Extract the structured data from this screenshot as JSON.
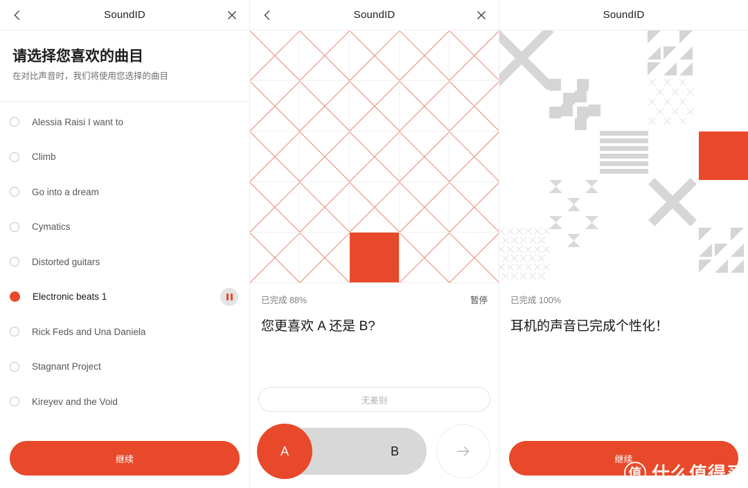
{
  "colors": {
    "accent": "#E8492A",
    "accent_light": "#E98571",
    "gray_shape": "#d5d5d5",
    "toggle_track": "#d8d8d8"
  },
  "panels": {
    "left": {
      "appbar": {
        "title": "SoundID",
        "back_icon": "chevron-left-icon",
        "close_icon": "close-icon"
      },
      "intro": {
        "title": "请选择您喜欢的曲目",
        "subtitle": "在对比声音时，我们将使用您选择的曲目"
      },
      "tracks": [
        {
          "label": "Alessia Raisi I want to",
          "selected": false
        },
        {
          "label": "Climb",
          "selected": false
        },
        {
          "label": "Go into a dream",
          "selected": false
        },
        {
          "label": "Cymatics",
          "selected": false
        },
        {
          "label": "Distorted guitars",
          "selected": false
        },
        {
          "label": "Electronic beats 1",
          "selected": true
        },
        {
          "label": "Rick Feds and Una Daniela",
          "selected": false
        },
        {
          "label": "Stagnant Project",
          "selected": false
        },
        {
          "label": "Kireyev and the Void",
          "selected": false
        }
      ],
      "pause_icon": "pause-icon",
      "cta_label": "继续"
    },
    "middle": {
      "appbar": {
        "title": "SoundID",
        "back_icon": "chevron-left-icon",
        "close_icon": "close-icon"
      },
      "progress_label": "已完成 88%",
      "pause_label": "暂停",
      "headline": "您更喜欢 A 还是 B?",
      "no_difference_label": "无差别",
      "option_a": "A",
      "option_b": "B",
      "next_icon": "arrow-right-icon",
      "artwork": {
        "type": "x-grid",
        "columns": 5,
        "rows": 5,
        "solid_cell": {
          "row": 5,
          "col": 3
        }
      }
    },
    "right": {
      "appbar": {
        "title": "SoundID"
      },
      "progress_label": "已完成 100%",
      "headline": "耳机的声音已完成个性化！",
      "cta_label": "继续",
      "artwork": {
        "type": "decorative-shapes"
      }
    }
  },
  "watermark": {
    "logo_char": "值",
    "text": "什么值得买"
  }
}
